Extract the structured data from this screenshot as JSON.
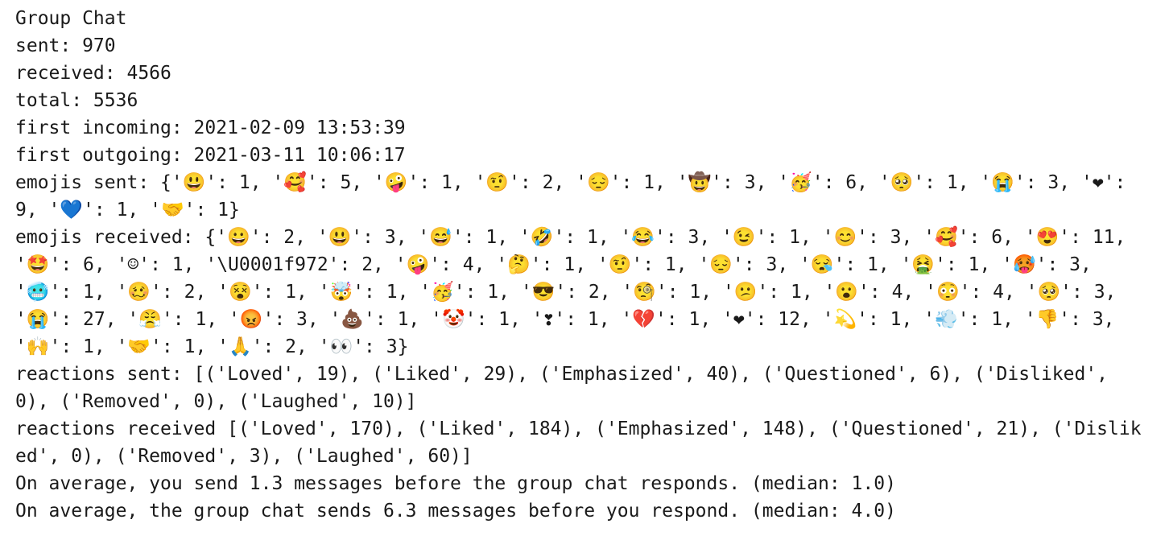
{
  "output": {
    "title": "Group Chat",
    "sent": "sent: 970",
    "received": "received: 4566",
    "total": "total: 5536",
    "first_incoming": "first incoming: 2021-02-09 13:53:39",
    "first_outgoing": "first outgoing: 2021-03-11 10:06:17",
    "emojis_sent": "emojis sent: {'😃': 1, '🥰': 5, '🤪': 1, '🤨': 2, '😔': 1, '🤠': 3, '🥳': 6, '🥺': 1, '😭': 3, '❤': 9, '💙': 1, '🤝': 1}",
    "emojis_received": "emojis received: {'😀': 2, '😃': 3, '😅': 1, '🤣': 1, '😂': 3, '😉': 1, '😊': 3, '🥰': 6, '😍': 11, '🤩': 6, '☺': 1, '\\U0001f972': 2, '🤪': 4, '🤔': 1, '🤨': 1, '😔': 3, '😪': 1, '🤮': 1, '🥵': 3, '🥶': 1, '🥴': 2, '😵': 1, '🤯': 1, '🥳': 1, '😎': 2, '🧐': 1, '😕': 1, '😮': 4, '😳': 4, '🥺': 3, '😭': 27, '😤': 1, '😡': 3, '💩': 1, '🤡': 1, '❣': 1, '💔': 1, '❤': 12, '💫': 1, '💨': 1, '👎': 3, '🙌': 1, '🤝': 1, '🙏': 2, '👀': 3}",
    "reactions_sent": "reactions sent: [('Loved', 19), ('Liked', 29), ('Emphasized', 40), ('Questioned', 6), ('Disliked', 0), ('Removed', 0), ('Laughed', 10)]",
    "reactions_received": "reactions received [('Loved', 170), ('Liked', 184), ('Emphasized', 148), ('Questioned', 21), ('Disliked', 0), ('Removed', 3), ('Laughed', 60)]",
    "avg_you": "On average, you send 1.3 messages before the group chat responds. (median: 1.0)",
    "avg_group": "On average, the group chat sends 6.3 messages before you respond. (median: 4.0)"
  }
}
